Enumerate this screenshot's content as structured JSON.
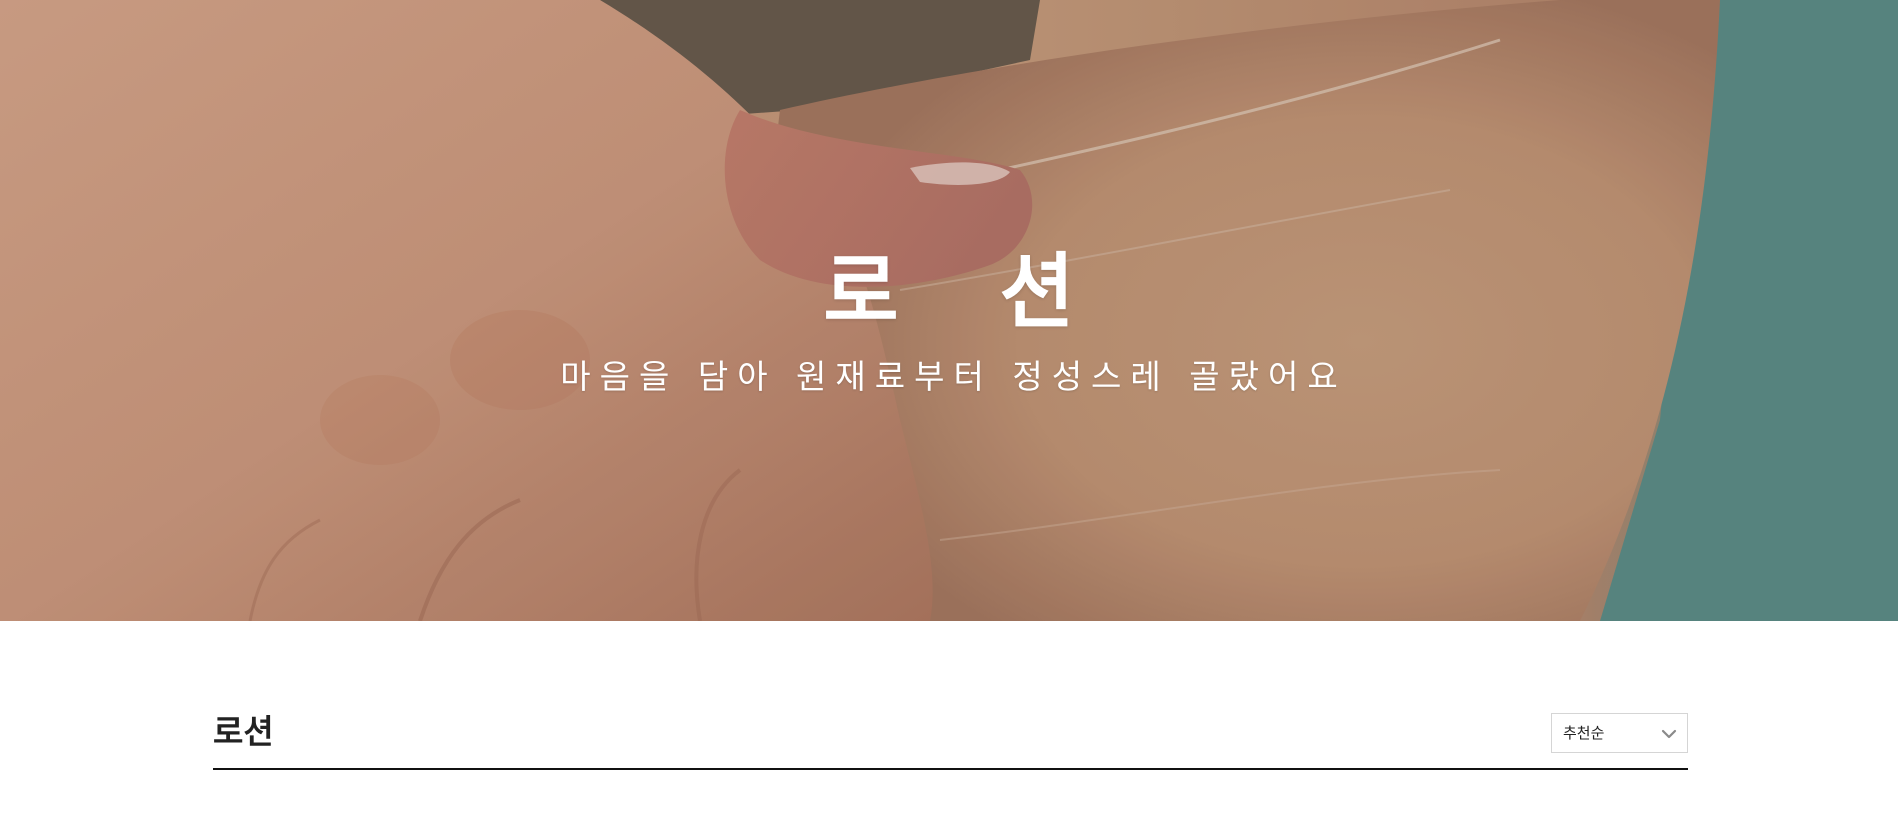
{
  "hero": {
    "title": "로 션",
    "subtitle": "마음을 담아 원재료부터 정성스레 골랐어요",
    "image_icon": "hands-applying-lotion-photo"
  },
  "list_header": {
    "title": "로션",
    "sort": {
      "selected": "추천순",
      "icon": "chevron-down-icon"
    }
  }
}
